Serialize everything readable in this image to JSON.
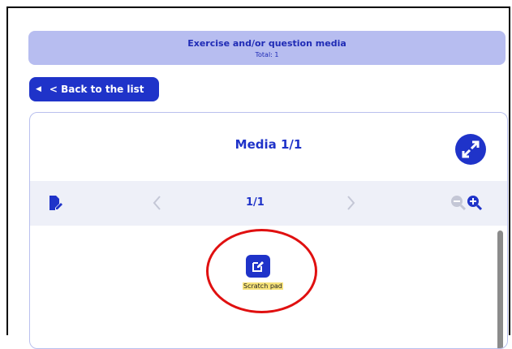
{
  "header": {
    "title": "Exercise and/or question media",
    "total": "Total: 1"
  },
  "nav": {
    "back_label": "< Back to the list"
  },
  "media": {
    "title": "Media 1/1",
    "pager": "1/1"
  },
  "scratch_pad": {
    "label": "Scratch pad"
  },
  "colors": {
    "primary": "#1f33c9",
    "banner_bg": "#b7bdf0",
    "highlight": "#f7e37a",
    "annotation_ring": "#e01010"
  },
  "icons": {
    "back": "triangle-left-icon",
    "expand": "expand-arrows-icon",
    "edit_doc": "file-edit-icon",
    "prev": "chevron-left-icon",
    "next": "chevron-right-icon",
    "zoom_out": "zoom-out-icon",
    "zoom_in": "zoom-in-icon",
    "scratch": "pencil-square-icon"
  }
}
